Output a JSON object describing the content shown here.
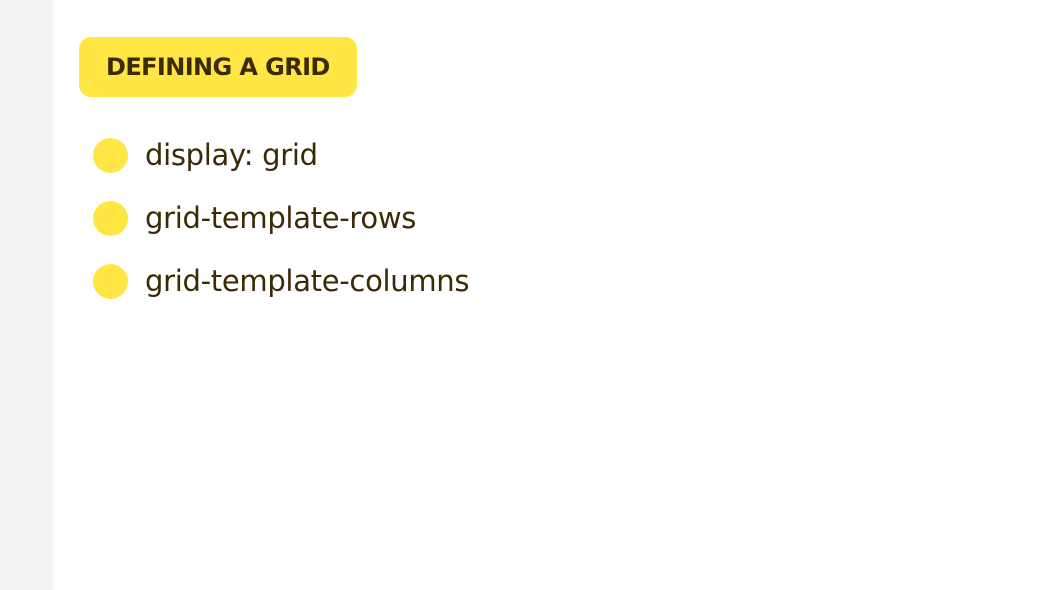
{
  "colors": {
    "accent": "#ffe645",
    "text": "#3a2a05",
    "gutter": "#f3f3f3",
    "background": "#ffffff"
  },
  "section": {
    "title": "DEFINING A GRID"
  },
  "bullets": [
    {
      "text": "display: grid"
    },
    {
      "text": "grid-template-rows"
    },
    {
      "text": "grid-template-columns"
    }
  ]
}
